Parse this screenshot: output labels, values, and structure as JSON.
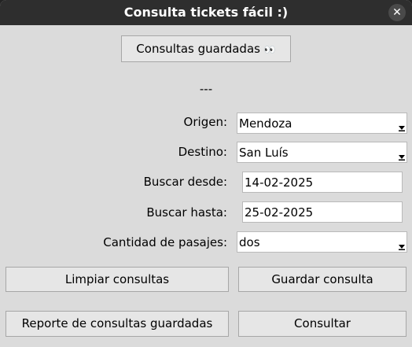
{
  "window": {
    "title": "Consulta tickets fácil :)",
    "close_glyph": "✕"
  },
  "top_button": {
    "label": "Consultas guardadas",
    "emoji": "👀"
  },
  "separator": "---",
  "form": {
    "origen": {
      "label": "Origen:",
      "value": "Mendoza"
    },
    "destino": {
      "label": "Destino:",
      "value": "San Luís"
    },
    "desde": {
      "label": "Buscar desde:",
      "value": "14-02-2025"
    },
    "hasta": {
      "label": "Buscar hasta:",
      "value": "25-02-2025"
    },
    "pasajes": {
      "label": "Cantidad de pasajes:",
      "value": "dos"
    }
  },
  "buttons": {
    "limpiar": "Limpiar consultas",
    "guardar": "Guardar consulta",
    "reporte": "Reporte de consultas guardadas",
    "consultar": "Consultar"
  }
}
